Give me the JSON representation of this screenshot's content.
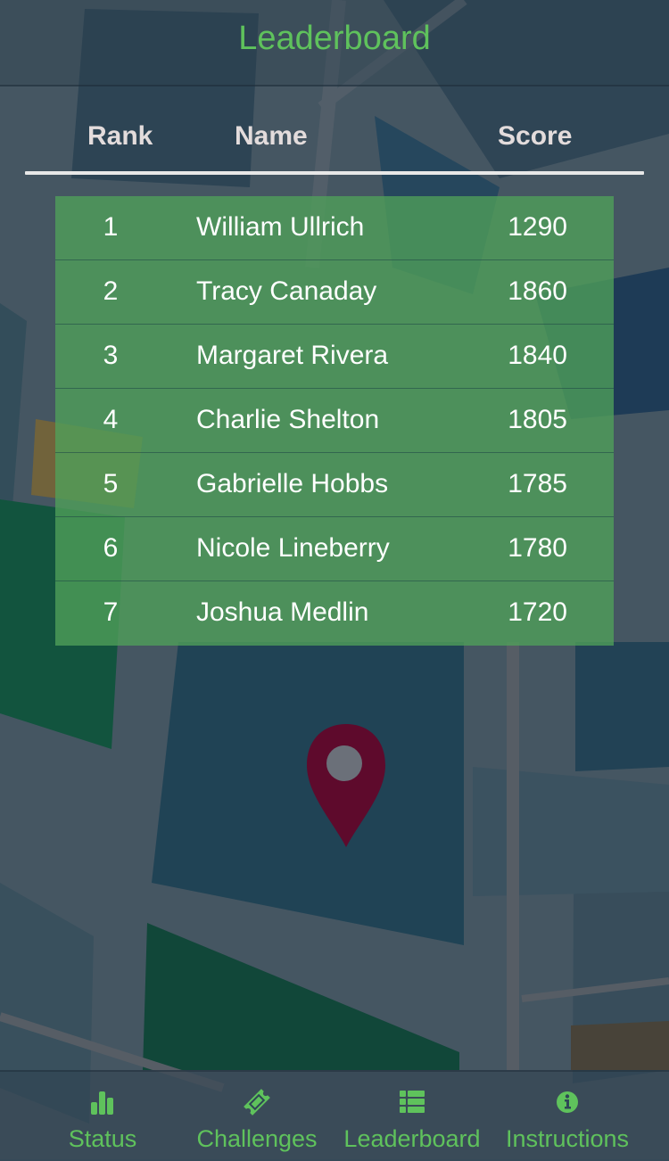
{
  "header": {
    "title": "Leaderboard"
  },
  "columns": {
    "rank": "Rank",
    "name": "Name",
    "score": "Score"
  },
  "rows": [
    {
      "rank": "1",
      "name": "William Ullrich",
      "score": "1290"
    },
    {
      "rank": "2",
      "name": "Tracy Canaday",
      "score": "1860"
    },
    {
      "rank": "3",
      "name": "Margaret Rivera",
      "score": "1840"
    },
    {
      "rank": "4",
      "name": "Charlie Shelton",
      "score": "1805"
    },
    {
      "rank": "5",
      "name": "Gabrielle Hobbs",
      "score": "1785"
    },
    {
      "rank": "6",
      "name": "Nicole Lineberry",
      "score": "1780"
    },
    {
      "rank": "7",
      "name": "Joshua Medlin",
      "score": "1720"
    }
  ],
  "nav": {
    "tabs": [
      {
        "label": "Status",
        "icon": "bar-chart-icon"
      },
      {
        "label": "Challenges",
        "icon": "ticket-icon"
      },
      {
        "label": "Leaderboard",
        "icon": "list-icon"
      },
      {
        "label": "Instructions",
        "icon": "info-circle-icon"
      }
    ]
  },
  "colors": {
    "accent": "#5fc25c",
    "table_bg": "#4f9a5c",
    "pin": "#6a0a2e",
    "header_text": "#e3dcdc"
  }
}
